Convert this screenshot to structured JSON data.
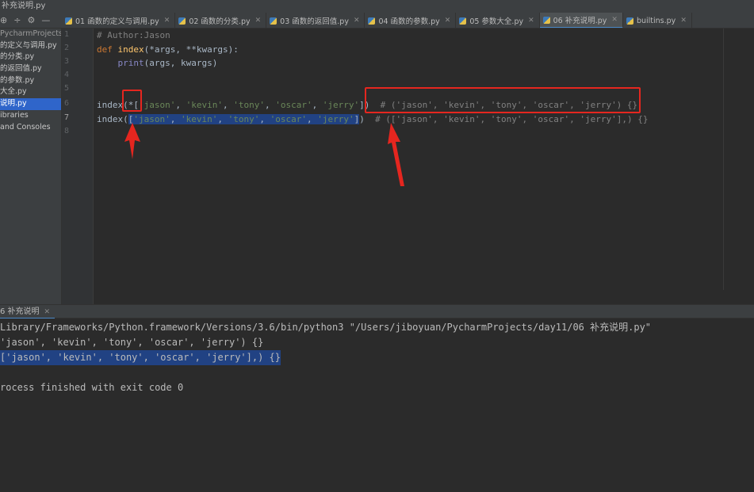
{
  "window": {
    "title": "补充说明.py"
  },
  "sidebar": {
    "tool_icons": [
      "target-icon",
      "split-icon",
      "gear-icon",
      "minus-icon"
    ],
    "tool_glyphs": [
      "⊕",
      "÷",
      "⚙",
      "—"
    ],
    "items": [
      {
        "label": "PycharmProjects/d",
        "dim": true
      },
      {
        "label": "的定义与调用.py"
      },
      {
        "label": "的分类.py"
      },
      {
        "label": "的返回值.py"
      },
      {
        "label": "的参数.py"
      },
      {
        "label": "大全.py"
      },
      {
        "label": "说明.py",
        "selected": true
      },
      {
        "label": "ibraries"
      },
      {
        "label": "and Consoles"
      }
    ]
  },
  "tabs": [
    {
      "label": "01 函数的定义与调用.py"
    },
    {
      "label": "02 函数的分类.py"
    },
    {
      "label": "03 函数的返回值.py"
    },
    {
      "label": "04 函数的参数.py"
    },
    {
      "label": "05 参数大全.py"
    },
    {
      "label": "06 补充说明.py",
      "active": true
    },
    {
      "label": "builtins.py"
    }
  ],
  "editor": {
    "line_numbers": [
      "1",
      "2",
      "3",
      "4",
      "5",
      "6",
      "7",
      "8"
    ],
    "code": {
      "l1_comment": "# Author:Jason",
      "l2_def": "def",
      "l2_name": "index",
      "l2_params": "(*args, **kwargs):",
      "l3_print": "print",
      "l3_args": "(args, kwargs)",
      "l6_call": "index(*[",
      "l6_s1": "'jason'",
      "l6_s2": "'kevin'",
      "l6_s3": "'tony'",
      "l6_s4": "'oscar'",
      "l6_s5": "'jerry'",
      "l6_close": "])",
      "l6_comment": "# ('jason', 'kevin', 'tony', 'oscar', 'jerry') {}",
      "l7_call": "index(",
      "l7_list_open": "[",
      "l7_s1": "'jason'",
      "l7_s2": "'kevin'",
      "l7_s3": "'tony'",
      "l7_s4": "'oscar'",
      "l7_s5": "'jerry'",
      "l7_list_close": "]",
      "l7_paren": ")",
      "l7_comment": "# (['jason', 'kevin', 'tony', 'oscar', 'jerry'],) {}",
      "comma": ", "
    }
  },
  "run_panel": {
    "tab_label": "6 补充说明",
    "output": [
      "Library/Frameworks/Python.framework/Versions/3.6/bin/python3 \"/Users/jiboyuan/PycharmProjects/day11/06 补充说明.py\"",
      "'jason', 'kevin', 'tony', 'oscar', 'jerry') {}",
      "['jason', 'kevin', 'tony', 'oscar', 'jerry'],) {}",
      "",
      "rocess finished with exit code 0"
    ]
  },
  "annotations": {
    "color": "#e5261f"
  }
}
